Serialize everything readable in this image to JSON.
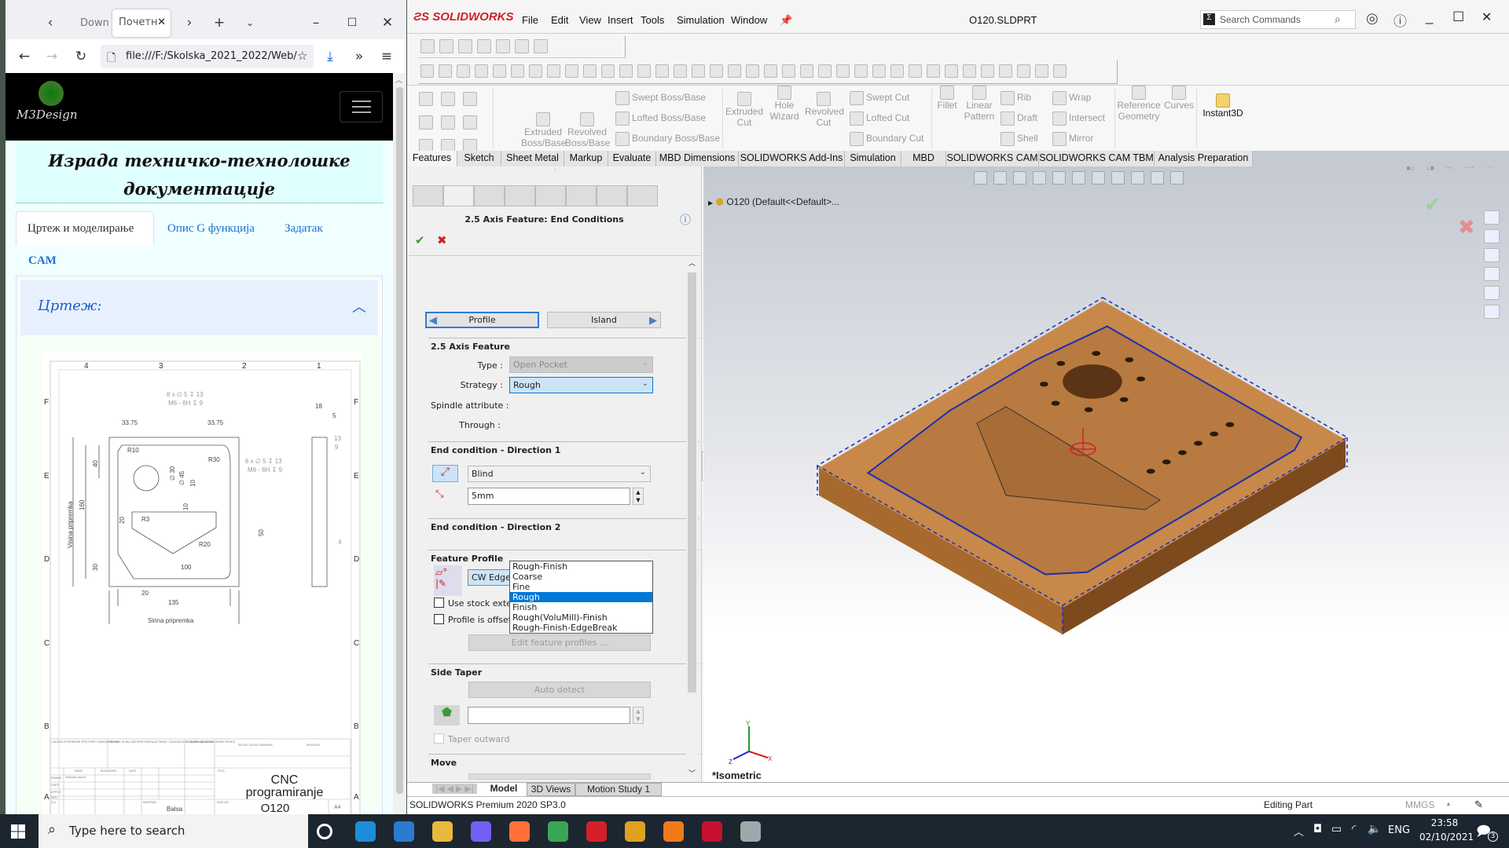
{
  "browser": {
    "tabs": [
      {
        "label": "Down",
        "active": false
      },
      {
        "label": "Почетн",
        "active": true
      }
    ],
    "url": "file:///F:/Skolska_2021_2022/Web/",
    "logo_text": "M3Design",
    "page_title_line1": "Израда техничко-технолошке",
    "page_title_line2": "документације",
    "nav_tabs": [
      "Цртеж и моделирање",
      "Опис G функција",
      "Задатак",
      "CAM"
    ],
    "accordion_title": "Цртеж:",
    "drawing": {
      "columns": [
        "4",
        "3",
        "2",
        "1"
      ],
      "rows": [
        "F",
        "E",
        "D",
        "C",
        "B",
        "A"
      ],
      "labels": [
        "8 x ∅ 5 ↧ 13",
        "M6 - 6H ↧ 9",
        "33.75",
        "33.75",
        "R10",
        "R30",
        "6 x ∅ 5 ↧ 13",
        "M6 - 6H ↧ 9",
        "40",
        "160",
        "Visina pripremka",
        "∅ 30",
        "∅ 45",
        "10",
        "10",
        "20",
        "R3",
        "R20",
        "50",
        "30",
        "100",
        "20",
        "135",
        "Sirina pripremka",
        "18",
        "5",
        "13",
        "9",
        "4"
      ],
      "title_block": {
        "cnc": "CNC",
        "programiranje": "programiranje",
        "dwg_no": "O120",
        "size": "A4",
        "do_not_scale": "DO NOT SCALE DRAWING",
        "revision": "REVISION",
        "title_lbl": "TITLE:",
        "name": "NAME",
        "signature": "SIGNATURE",
        "date": "DATE",
        "drawn": "DRAWN",
        "chkd": "CHK'D",
        "appvd": "APPV'D",
        "mfg": "MFG",
        "qa": "Q.A",
        "drawn_by": "Slobodan Ivkovic",
        "material_lbl": "MATERIAL:",
        "material": "Balsa",
        "dwg_lbl": "DWG NO.",
        "finish": "FINISH:",
        "deburr": "DEBURR AND BREAK SHARP EDGES",
        "unless": "UNLESS OTHERWISE SPECIFIED: DIMENSIONS ARE IN MILLIMETERS SURFACE FINISH: TOLERANCES: LINEAR: ANGULAR:"
      }
    }
  },
  "solidworks": {
    "brand": "SOLIDWORKS",
    "menu": [
      "File",
      "Edit",
      "View",
      "Insert",
      "Tools",
      "Simulation",
      "Window"
    ],
    "document_title": "O120.SLDPRT",
    "search_placeholder": "Search Commands",
    "toolbar1_icons": [
      "home-icon",
      "new-icon",
      "open-icon",
      "save-icon",
      "print-icon",
      "options-icon",
      "undo-icon"
    ],
    "toolbar2_icon_count_label": "",
    "command_manager": {
      "extruded_boss": "Extruded Boss/Base",
      "revolved_boss": "Revolved Boss/Base",
      "swept_boss": "Swept Boss/Base",
      "lofted_boss": "Lofted Boss/Base",
      "boundary_boss": "Boundary Boss/Base",
      "extruded_cut": "Extruded Cut",
      "hole_wizard": "Hole Wizard",
      "revolved_cut": "Revolved Cut",
      "swept_cut": "Swept Cut",
      "lofted_cut": "Lofted Cut",
      "boundary_cut": "Boundary Cut",
      "fillet": "Fillet",
      "linear_pattern": "Linear Pattern",
      "rib": "Rib",
      "draft": "Draft",
      "shell": "Shell",
      "wrap": "Wrap",
      "intersect": "Intersect",
      "mirror": "Mirror",
      "reference_geometry": "Reference Geometry",
      "curves": "Curves",
      "instant3d": "Instant3D"
    },
    "tabs": [
      "Features",
      "Sketch",
      "Sheet Metal",
      "Markup",
      "Evaluate",
      "MBD Dimensions",
      "SOLIDWORKS Add-Ins",
      "Simulation",
      "MBD",
      "SOLIDWORKS CAM",
      "SOLIDWORKS CAM TBM",
      "Analysis Preparation"
    ],
    "active_tab": "Features",
    "panel": {
      "title": "2.5 Axis Feature: End Conditions",
      "profile_button": "Profile",
      "island_button": "Island",
      "section_axis": "2.5 Axis Feature",
      "type_label": "Type :",
      "type_value": "Open Pocket",
      "strategy_label": "Strategy :",
      "strategy_value": "Rough",
      "strategy_options": [
        "Rough-Finish",
        "Coarse",
        "Fine",
        "Rough",
        "Finish",
        "Rough(VoluMill)-Finish",
        "Rough-Finish-EdgeBreak"
      ],
      "spindle_label": "Spindle attribute :",
      "through_label": "Through :",
      "section_end1": "End condition - Direction 1",
      "end_type": "Blind",
      "depth": "5mm",
      "section_end2": "End condition - Direction 2",
      "section_profile": "Feature Profile",
      "profile_value": "CW Edge-30",
      "use_stock": "Use stock extents",
      "use_stock_checked": false,
      "profile_offset": "Profile is offset",
      "profile_offset_checked": false,
      "edit_profiles": "Edit feature profiles ...",
      "section_taper": "Side Taper",
      "auto_detect": "Auto detect",
      "taper_value": "",
      "taper_outward": "Taper outward",
      "taper_outward_checked": false,
      "section_move": "Move"
    },
    "tree_item": "O120  (Default<<Default>...",
    "view_name": "*Isometric",
    "bottom_tabs": [
      "Model",
      "3D Views",
      "Motion Study 1"
    ],
    "active_bottom_tab": "Model",
    "status_left": "SOLIDWORKS Premium 2020 SP3.0",
    "status_mode": "Editing Part",
    "status_units": "MMGS",
    "colors": {
      "wood": "#c8884a",
      "pocket_edge": "#1b2fb0",
      "accent_blue": "#0078d7"
    }
  },
  "taskbar": {
    "search_placeholder": "Type here to search",
    "apps": [
      "cortana-icon",
      "edge-icon",
      "mail-icon",
      "file-explorer-icon",
      "viber-icon",
      "firefox-icon",
      "chrome-icon",
      "opera-icon",
      "media-player-icon",
      "sublime-icon",
      "solidworks-icon",
      "app-icon"
    ],
    "language": "ENG",
    "time": "23:58",
    "date": "02/10/2021",
    "notifications": "3"
  }
}
